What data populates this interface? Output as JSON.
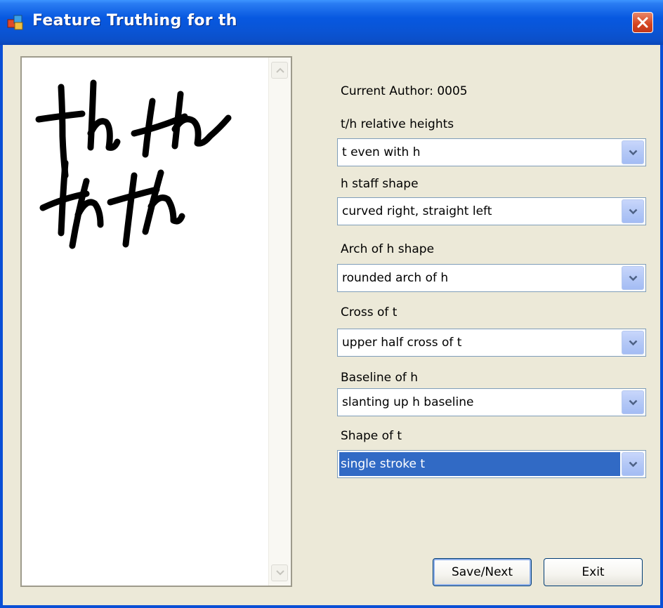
{
  "window": {
    "title": "Feature Truthing for th",
    "icon": "app-icon"
  },
  "author": {
    "label": "Current Author: 0005"
  },
  "features": [
    {
      "label": "t/h relative heights",
      "value": "t even with h"
    },
    {
      "label": "h staff shape",
      "value": "curved right, straight left"
    },
    {
      "label": "Arch of h shape",
      "value": "rounded arch of h"
    },
    {
      "label": "Cross of t",
      "value": "upper half cross of t"
    },
    {
      "label": "Baseline of h",
      "value": "slanting up h baseline"
    },
    {
      "label": "Shape of t",
      "value": "single stroke t"
    }
  ],
  "buttons": {
    "save_next": "Save/Next",
    "exit": "Exit"
  },
  "colors": {
    "titlebar": "#0a54d4",
    "selection": "#316ac5",
    "background": "#ece9d8"
  }
}
